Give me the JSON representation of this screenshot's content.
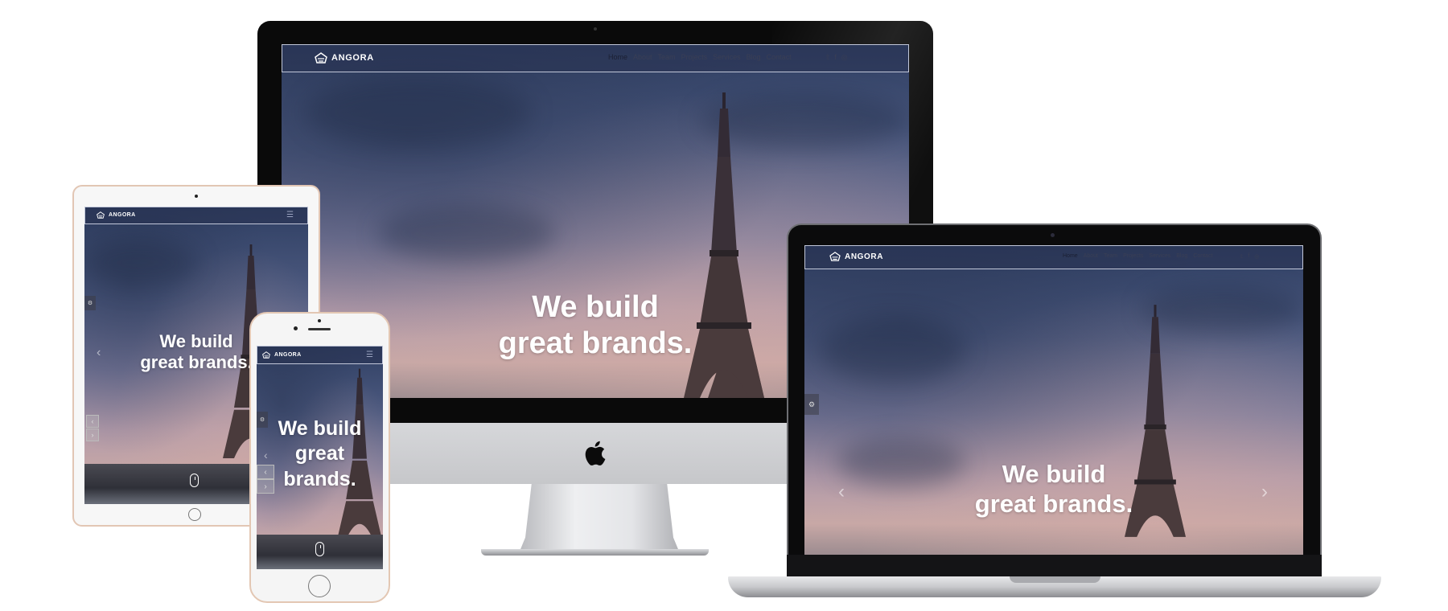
{
  "brand": "ANGORA",
  "hero_desktop": [
    "We build",
    "great brands."
  ],
  "hero_tablet": [
    "We build",
    "great brands."
  ],
  "hero_phone": [
    "We build",
    "great",
    "brands."
  ],
  "nav": [
    "Home",
    "About",
    "Team",
    "Projects",
    "Services",
    "Blog",
    "Contact"
  ],
  "social_icons": [
    "twitter-icon",
    "facebook-icon",
    "instagram-icon"
  ],
  "social_glyphs": [
    "𝕥",
    "f",
    "◎"
  ],
  "glyphs": {
    "prev": "‹",
    "next": "›",
    "settings": "⚙",
    "menu": "☰",
    "chevron_left": "‹",
    "chevron_right": "›"
  },
  "colors": {
    "sky_top": "#2f3f63",
    "sky_bottom": "#c8a8a6",
    "navbar_border": "#dce1f0"
  }
}
